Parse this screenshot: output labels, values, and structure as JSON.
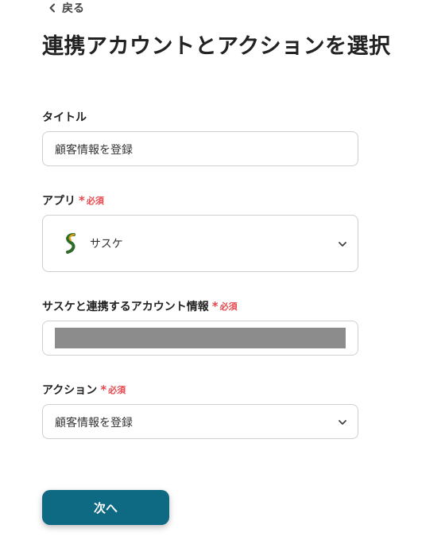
{
  "back": {
    "label": "戻る"
  },
  "page": {
    "title": "連携アカウントとアクションを選択"
  },
  "fields": {
    "title": {
      "label": "タイトル",
      "value": "顧客情報を登録"
    },
    "app": {
      "label": "アプリ",
      "required": "必須",
      "value": "サスケ"
    },
    "account": {
      "label": "サスケと連携するアカウント情報",
      "required": "必須"
    },
    "action": {
      "label": "アクション",
      "required": "必須",
      "value": "顧客情報を登録"
    }
  },
  "buttons": {
    "next": "次へ"
  },
  "colors": {
    "primary": "#0e6983",
    "required": "#e5484d"
  },
  "icons": {
    "back": "chevron-left-icon",
    "dropdown": "chevron-down-icon",
    "required": "asterisk-icon",
    "app_logo": "saske-logo-icon"
  }
}
